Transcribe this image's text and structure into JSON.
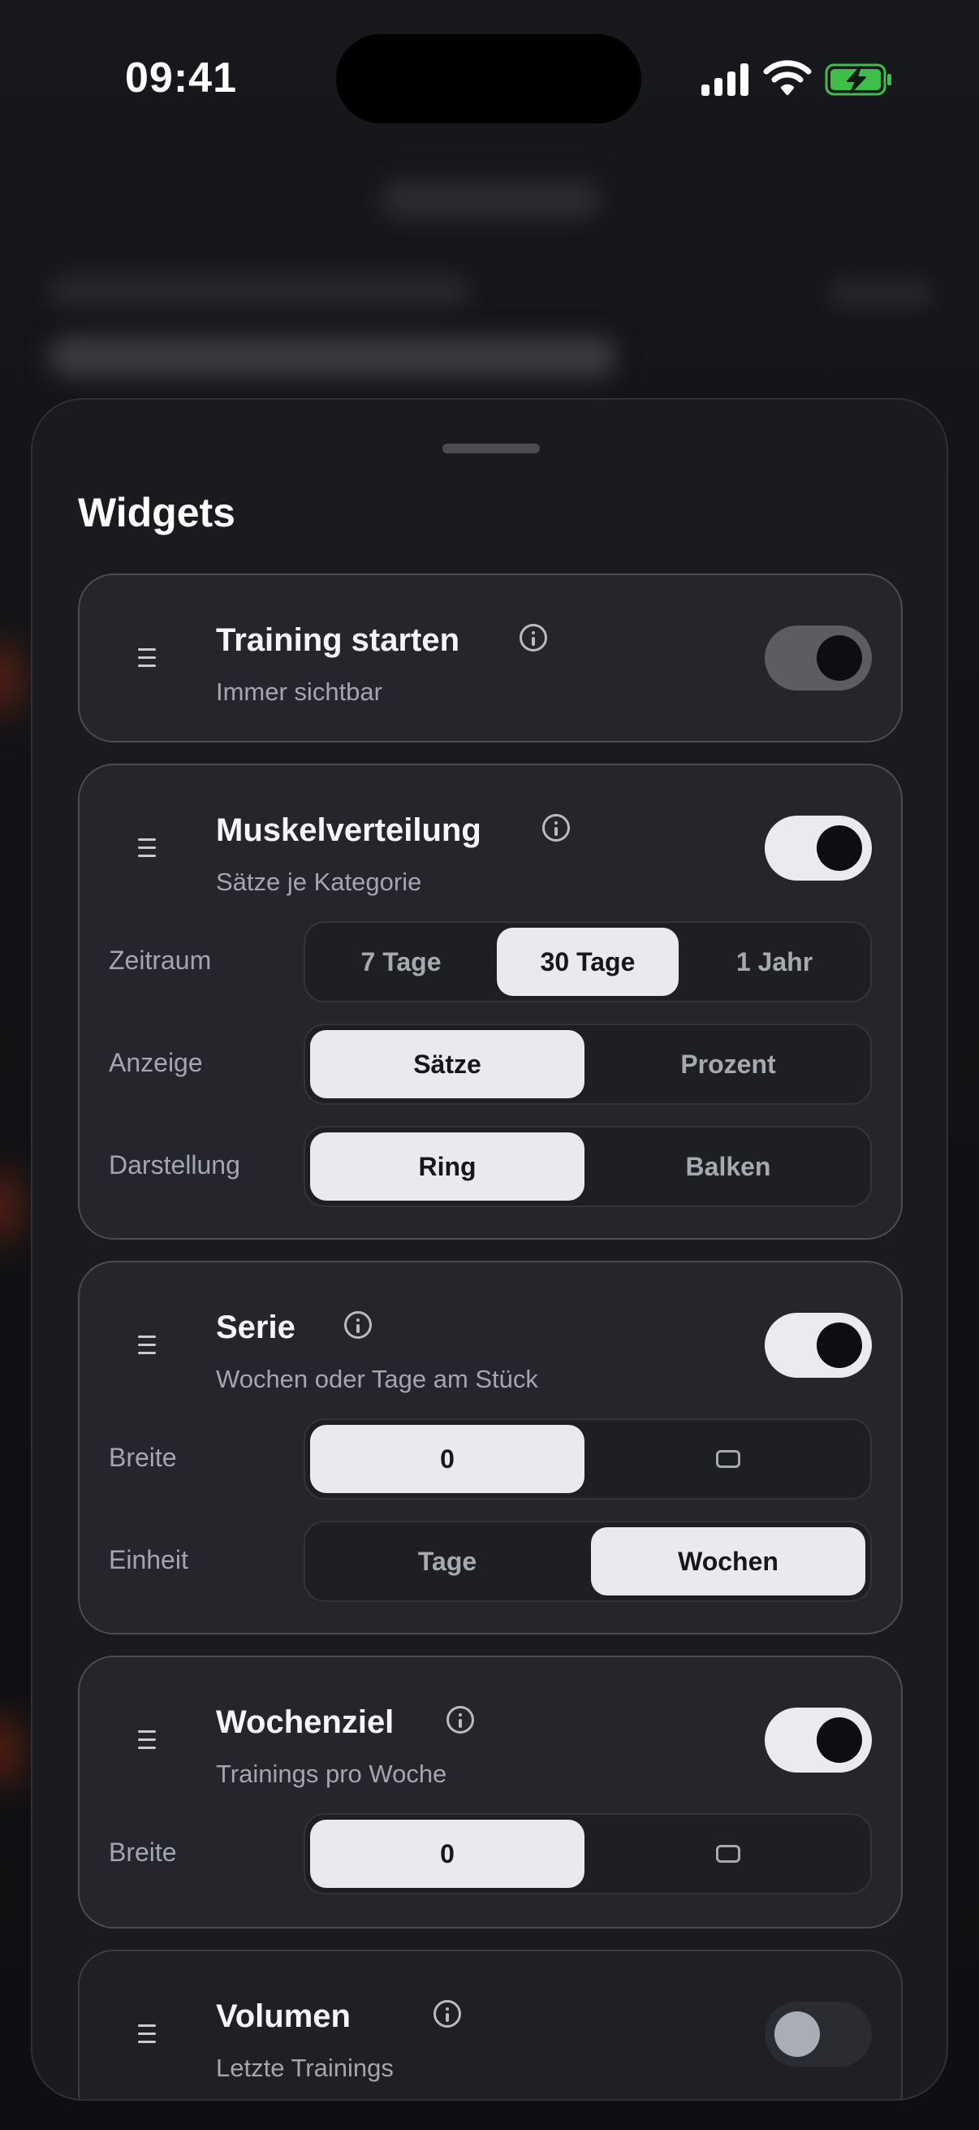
{
  "status_bar": {
    "time": "09:41"
  },
  "sheet": {
    "title": "Widgets"
  },
  "widgets": [
    {
      "title": "Training starten",
      "subtitle": "Immer sichtbar",
      "toggle": "on-disabled"
    },
    {
      "title": "Muskelverteilung",
      "subtitle": "Sätze je Kategorie",
      "toggle": "on",
      "settings": [
        {
          "label": "Zeitraum",
          "options": [
            "7 Tage",
            "30 Tage",
            "1 Jahr"
          ],
          "selected": "30 Tage"
        },
        {
          "label": "Anzeige",
          "options": [
            "Sätze",
            "Prozent"
          ],
          "selected": "Sätze"
        },
        {
          "label": "Darstellung",
          "options": [
            "Ring",
            "Balken"
          ],
          "selected": "Ring"
        }
      ]
    },
    {
      "title": "Serie",
      "subtitle": "Wochen oder Tage am Stück",
      "toggle": "on",
      "settings": [
        {
          "label": "Breite",
          "options": [
            "0",
            "wide-rect-icon"
          ],
          "selected": "0"
        },
        {
          "label": "Einheit",
          "options": [
            "Tage",
            "Wochen"
          ],
          "selected": "Wochen"
        }
      ]
    },
    {
      "title": "Wochenziel",
      "subtitle": "Trainings pro Woche",
      "toggle": "on",
      "settings": [
        {
          "label": "Breite",
          "options": [
            "0",
            "wide-rect-icon"
          ],
          "selected": "0"
        }
      ]
    },
    {
      "title": "Volumen",
      "subtitle": "Letzte Trainings",
      "toggle": "off"
    }
  ]
}
